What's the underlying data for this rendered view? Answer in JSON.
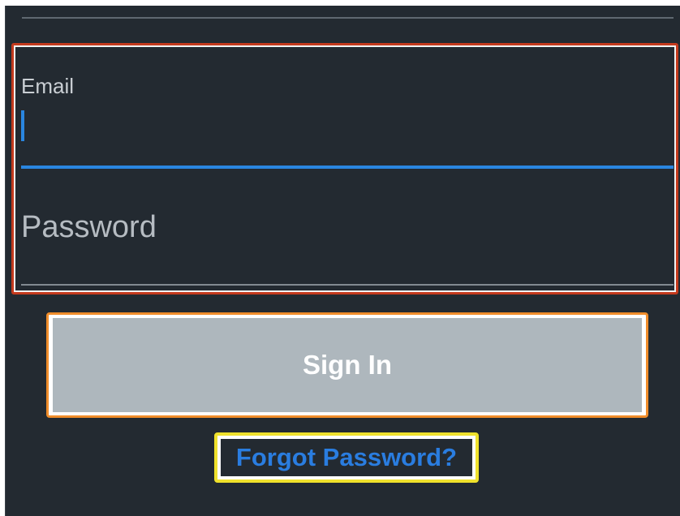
{
  "form": {
    "email_label": "Email",
    "email_value": "",
    "password_placeholder": "Password",
    "password_value": ""
  },
  "actions": {
    "sign_in_label": "Sign In",
    "forgot_password_label": "Forgot Password?"
  },
  "colors": {
    "background": "#232a31",
    "accent_blue": "#2a86e0",
    "button_disabled": "#aeb7bd",
    "highlight_red": "#c43a1d",
    "highlight_orange": "#f08d2b",
    "highlight_yellow": "#efe12c"
  }
}
